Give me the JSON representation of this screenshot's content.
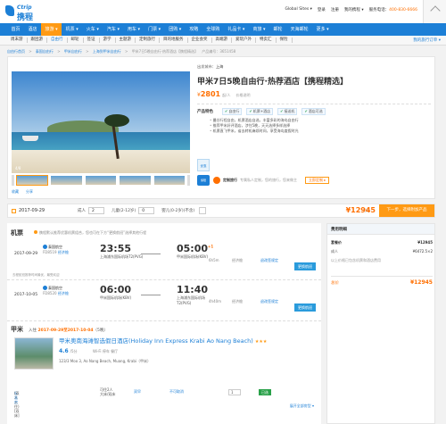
{
  "header": {
    "logo_en": "Ctrip",
    "logo_cn": "携程",
    "links": [
      "Global Sites ▾",
      "登录",
      "注册",
      "我的携程 ▾"
    ],
    "phone_label": "服务电话：",
    "phone": "400-830-6666",
    "scroll_top_label": "回到顶部"
  },
  "nav": {
    "items": [
      "首页",
      "酒店",
      "旅游 ▾",
      "机票 ▾",
      "火车 ▾",
      "汽车 ▾",
      "用车 ▾",
      "门票 ▾",
      "团购 ▾",
      "攻略",
      "全球购",
      "礼品卡 ▾",
      "商旅 ▾",
      "邮轮",
      "天海邮轮",
      "更多 ▾"
    ],
    "active_index": 2,
    "right_label": "礼品卡",
    "right_tag": "特惠"
  },
  "subnav": {
    "items": [
      "周末游",
      "跟团游",
      "自由行",
      "邮轮",
      "签证",
      "游学",
      "主题游",
      "定制旅行",
      "目的地服务",
      "企业会奖",
      "高端游",
      "爱玩户外",
      "特卖汇",
      "保险",
      "特卖汇"
    ],
    "selected_index": 2,
    "member_label": "我的旅行订单 ▾"
  },
  "breadcrumbs": [
    "自由行首页",
    ">",
    "泰国自由行",
    ">",
    "甲米自由行",
    ">",
    "上海到甲米自由行",
    ">",
    "甲米7日5晚自由行·热荐酒店【携程精选】",
    "产品编号：3651458"
  ],
  "product": {
    "departure_label": "出发城市：",
    "departure": "上海",
    "title": "甲米7日5晚自由行·热荐酒店【携程精选】",
    "price_symbol": "¥",
    "price": "2801",
    "price_unit": "起/人",
    "price_note": "价格说明",
    "image_index": "4/8",
    "feature_label": "产品特色",
    "badges": [
      "自由行",
      "机票+酒店",
      "接送机",
      "酒店可选"
    ],
    "bullets": [
      "曼谷行程自由，机票酒店自选，丰富多彩的海岛自由行",
      "推荐甲米好评酒店，涉住5晚，天天选择多样选择",
      "机票直飞甲米，省去转机麻烦时间，享受海岛度假时光"
    ],
    "promo_label": "优惠",
    "shield_label": "保障",
    "custom_name": "定制旅行",
    "custom_text": "专属私人定制，您的旅行，您来做主",
    "custom_btn": "立即定制 ▸",
    "fav_labels": [
      "收藏",
      "分享"
    ]
  },
  "booking": {
    "date": "2017-09-29",
    "adult_label": "成人",
    "adults": "2",
    "child_label": "儿童(2-12岁)",
    "children": "0",
    "baby_label": "婴儿(0-2岁)(不含)",
    "total_label": "总价",
    "total": "¥12945",
    "go_label": "下一步，选择附加产品"
  },
  "flights": {
    "section_title": "机票",
    "hint": "携程默认推荐优惠机票组合，您也可在下方“更换航班”选择其他行程",
    "list": [
      {
        "date": "2017-09-29",
        "airline": "泰国航空",
        "flight_no": "FD8519",
        "cabin": "经济舱",
        "dep_time": "23:55",
        "dep_airport": "上海浦东国际机场T2(PVG)",
        "arr_time": "05:00",
        "arr_plus": "+1",
        "arr_airport": "甲米国际机场(KBV)",
        "duration": "6h5m",
        "stop": "经济舱",
        "rule": "退改签规定",
        "change_btn": "更换航班",
        "foot": "去程航班推荐时间最优，最受欢迎"
      },
      {
        "date": "2017-10-05",
        "airline": "泰国航空",
        "flight_no": "FD8520",
        "cabin": "经济舱",
        "dep_time": "06:00",
        "dep_airport": "甲米国际机场(KBV)",
        "arr_time": "11:40",
        "arr_plus": "",
        "arr_airport": "上海浦东国际机场T2(PVG)",
        "duration": "4h40m",
        "stop": "经济舱",
        "rule": "退改签规定",
        "change_btn": "更换航班",
        "foot": ""
      }
    ]
  },
  "hotel": {
    "city": "甲米",
    "checkin_label": "入住",
    "dates": "2017-09-29至2017-10-04",
    "nights": "（5晚）",
    "name": "甲米奥南海滩智选假日酒店(Holiday Inn Express Krabi Ao Nang Beach)",
    "stars": "★★★",
    "score": "4.6",
    "score_unit": "/5分",
    "facilities": "Wi-Fi  停车  餐厅",
    "address": "123/3 Moo 3, Ao Nang Beach, Muang, Krabi（甲米）",
    "room": {
      "name": "标准房",
      "type": "(双人入住)[双床]",
      "max": "可住2人",
      "bed": "大床/双床",
      "breakfast": "双早",
      "cancel": "不可取消",
      "count": "1",
      "select": "已选"
    },
    "more_rooms": "展开全部房型 ▾"
  },
  "summary": {
    "title": "费用明细",
    "rows": [
      {
        "k": "套餐价",
        "v": "¥12945"
      },
      {
        "k": "成人",
        "v": "¥6472.5×2"
      },
      {
        "k": "以上价格已包含机票和酒店费用",
        "v": ""
      }
    ],
    "total_label": "总价",
    "total": "¥12945"
  }
}
